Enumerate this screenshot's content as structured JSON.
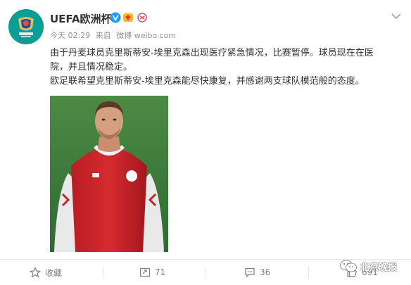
{
  "account": {
    "name": "UEFA欧洲杯",
    "avatar_icon": "euro2020-logo-icon",
    "accent": "#0a9e96"
  },
  "meta": {
    "time": "今天 02:29",
    "from_label": "来自",
    "source": "微博 weibo.com"
  },
  "post": {
    "line1": "由于丹麦球员克里斯蒂安-埃里克森出现医疗紧急情况，比赛暂停。球员现在在医",
    "line2": "院，并且情况稳定。",
    "line3": "欧足联希望克里斯蒂安-埃里克森能尽快康复，并感谢两支球队模范般的态度。",
    "image_icon": "player-photo"
  },
  "actions": {
    "favorite_label": "收藏",
    "repost_count": "71",
    "comment_count": "36",
    "like_count": "691"
  },
  "watermark": {
    "text": "北京晚报"
  }
}
